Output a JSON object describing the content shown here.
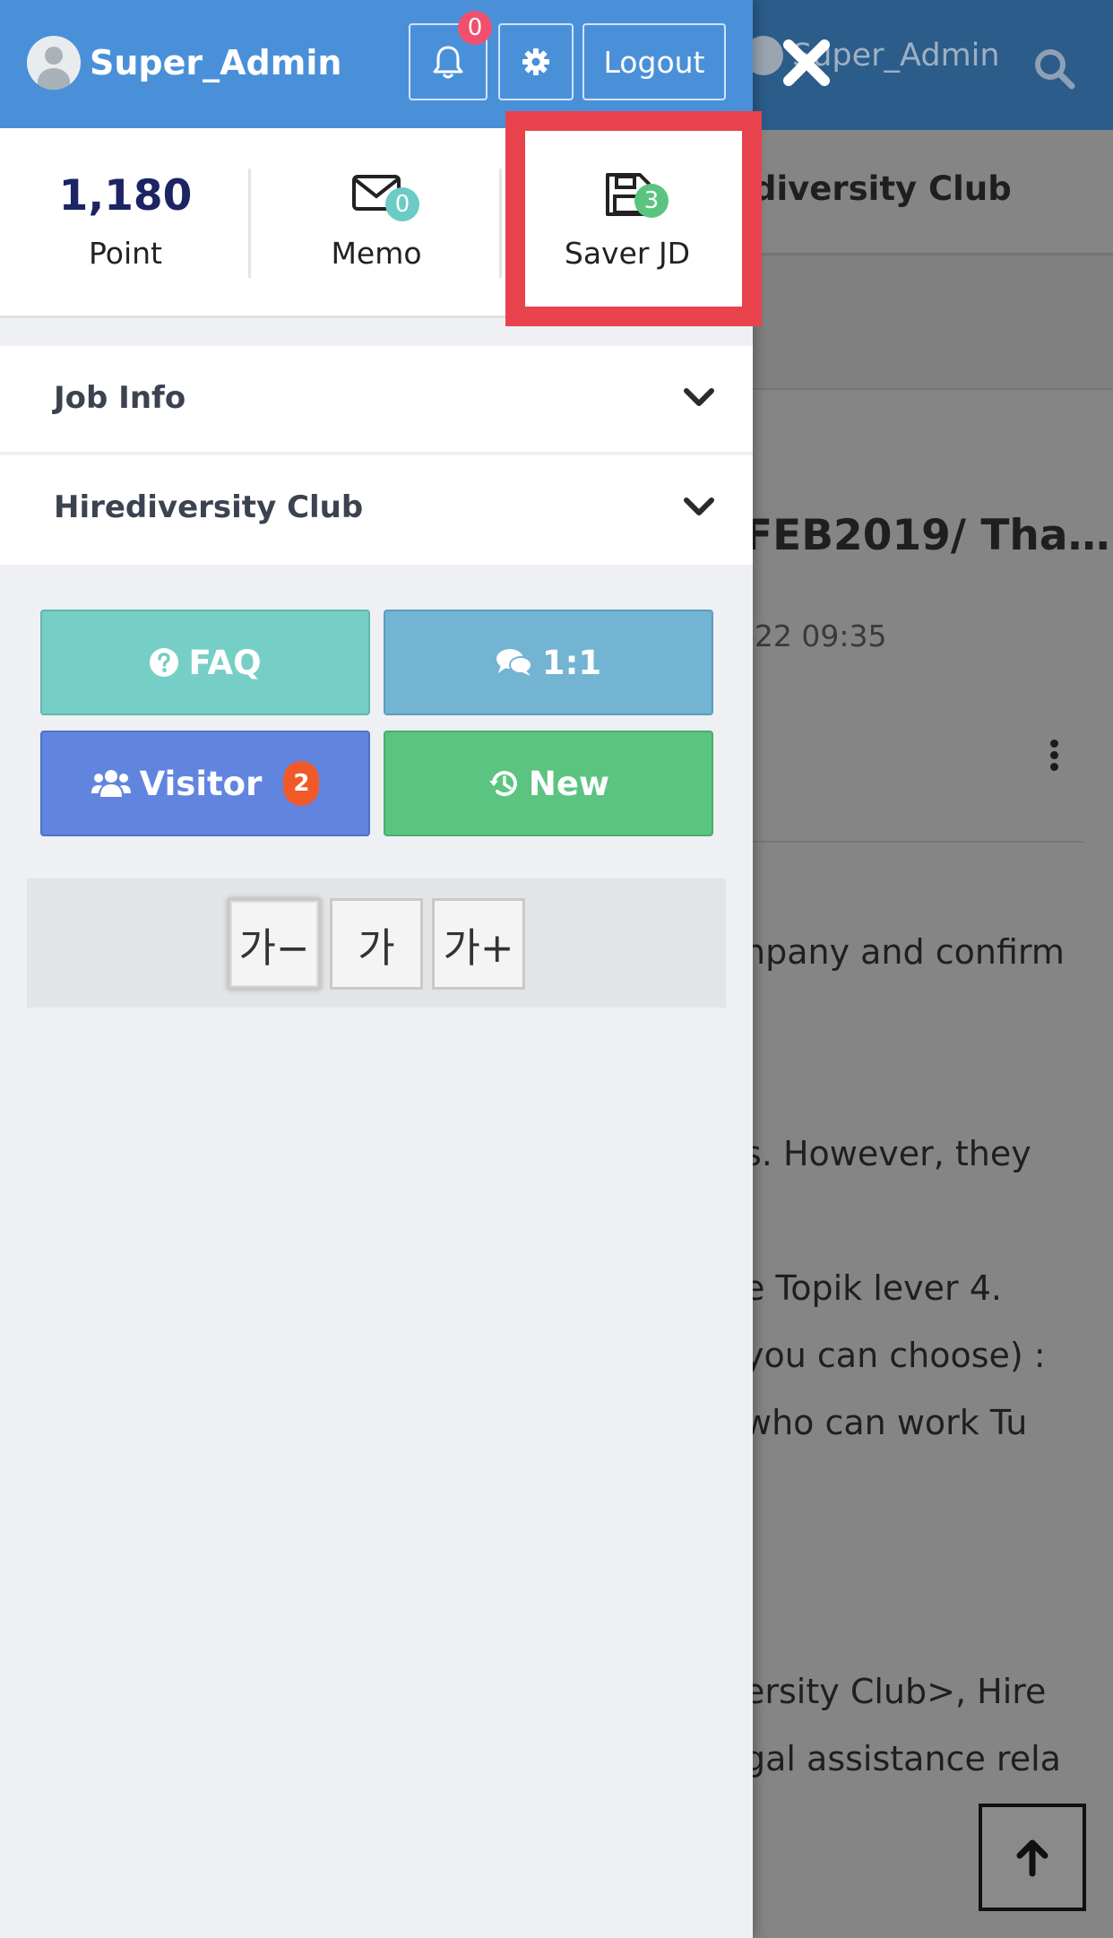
{
  "background": {
    "header_user": "Super_Admin",
    "board_title": "diversity Club",
    "post_title": "FEB2019/ Tha…",
    "post_date": "-22 09:35",
    "lines": [
      "npany and confirm",
      "s. However, they",
      "e Topik lever 4.",
      "you can choose) :",
      " who can work Tu",
      "ersity Club>, Hire",
      "gal assistance rela"
    ]
  },
  "drawer": {
    "user_name": "Super_Admin",
    "notification_count": "0",
    "logout_label": "Logout",
    "stats": {
      "point_value": "1,180",
      "point_label": "Point",
      "memo_count": "0",
      "memo_label": "Memo",
      "saver_count": "3",
      "saver_label": "Saver JD"
    },
    "menus": [
      {
        "label": "Job Info"
      },
      {
        "label": "Hirediversity Club"
      }
    ],
    "buttons": {
      "faq": "FAQ",
      "chat": "1:1",
      "visitor": "Visitor",
      "visitor_count": "2",
      "new": "New"
    },
    "font_sizes": [
      "가−",
      "가",
      "가+"
    ]
  },
  "colors": {
    "header_blue": "#4a90d9",
    "highlight_red": "#e8434d",
    "faq_teal": "#76cfc6",
    "chat_blue": "#73b4d2",
    "visitor_indigo": "#6185df",
    "new_green": "#5bc480"
  }
}
